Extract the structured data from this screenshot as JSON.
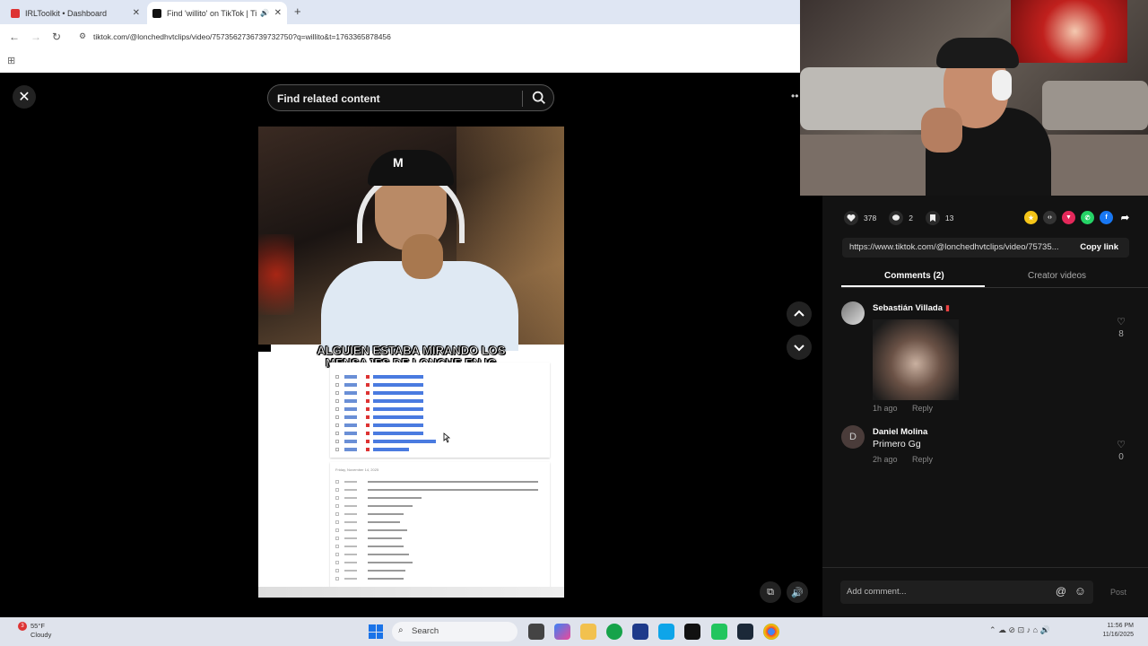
{
  "browser": {
    "tabs": [
      {
        "title": "IRLToolkit • Dashboard",
        "active": false
      },
      {
        "title": "Find 'willito' on TikTok | Tik",
        "active": true
      }
    ],
    "url": "tiktok.com/@lonchedhvtclips/video/7573562736739732750?q=willito&t=1763365878456"
  },
  "search": {
    "placeholder": "Find related content"
  },
  "video": {
    "caption_line1": "ALGUIEN ESTABA MIRANDO LOS",
    "caption_line2": "MENSAJES DE LONCHE EN IG",
    "doc_date": "Friday, November 14, 2025",
    "cap_logo": "M"
  },
  "stats": {
    "likes": "378",
    "comments": "2",
    "saves": "13"
  },
  "share": {
    "link": "https://www.tiktok.com/@lonchedhvtclips/video/75735...",
    "copy_label": "Copy link"
  },
  "tabs": {
    "comments": "Comments (2)",
    "creator": "Creator videos"
  },
  "comments": [
    {
      "author": "Sebastián Villada",
      "text": "",
      "time": "1h ago",
      "reply": "Reply",
      "likes": "8",
      "has_image": true
    },
    {
      "author": "Daniel Molina",
      "avatar_letter": "D",
      "text": "Primero Gg",
      "time": "2h ago",
      "reply": "Reply",
      "likes": "0"
    }
  ],
  "composer": {
    "placeholder": "Add comment...",
    "post": "Post"
  },
  "taskbar": {
    "weather_temp": "55°F",
    "weather_desc": "Cloudy",
    "notification_count": "3",
    "search": "Search",
    "time": "11:56 PM",
    "date": "11/16/2025"
  },
  "colors": {
    "tiktok_bg": "#121212",
    "taskbar": "#dfe3ec",
    "accent_blue": "#1a73e8"
  }
}
